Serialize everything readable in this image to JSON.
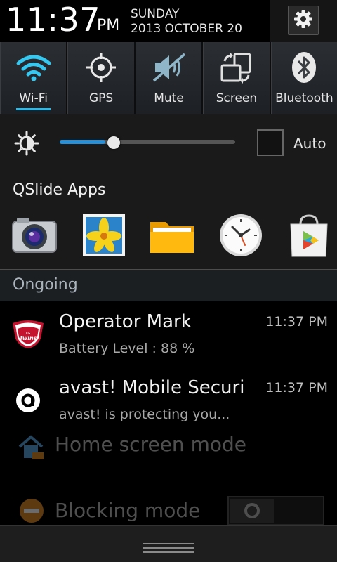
{
  "header": {
    "time": "11:37",
    "ampm": "PM",
    "day": "SUNDAY",
    "date": "2013 OCTOBER 20",
    "settings_icon": "gear-icon"
  },
  "toggles": [
    {
      "label": "Wi-Fi",
      "icon": "wifi-icon",
      "active": true
    },
    {
      "label": "GPS",
      "icon": "gps-icon",
      "active": false
    },
    {
      "label": "Mute",
      "icon": "mute-icon",
      "active": false
    },
    {
      "label": "Screen",
      "icon": "screen-rotation-icon",
      "active": false
    },
    {
      "label": "Bluetooth",
      "icon": "bluetooth-icon",
      "active": false
    }
  ],
  "brightness": {
    "level": 0.26,
    "auto_label": "Auto",
    "auto_checked": false
  },
  "qslide": {
    "title": "QSlide Apps",
    "apps": [
      "camera-icon",
      "gallery-icon",
      "file-manager-icon",
      "clock-icon",
      "play-store-icon"
    ]
  },
  "ongoing": {
    "label": "Ongoing"
  },
  "notifications": [
    {
      "title": "Operator Mark",
      "subtitle": "Battery Level : 88 %",
      "time": "11:37 PM",
      "icon": "lg-twins-icon"
    },
    {
      "title": "avast! Mobile Securi",
      "subtitle": "avast! is protecting you...",
      "time": "11:37 PM",
      "icon": "avast-icon"
    }
  ],
  "background_rows": [
    {
      "label": "Home screen mode",
      "icon": "home-icon"
    },
    {
      "label": "Blocking mode",
      "icon": "block-icon"
    }
  ],
  "colors": {
    "accent": "#2fb8e6",
    "slider": "#2b8fd6"
  }
}
